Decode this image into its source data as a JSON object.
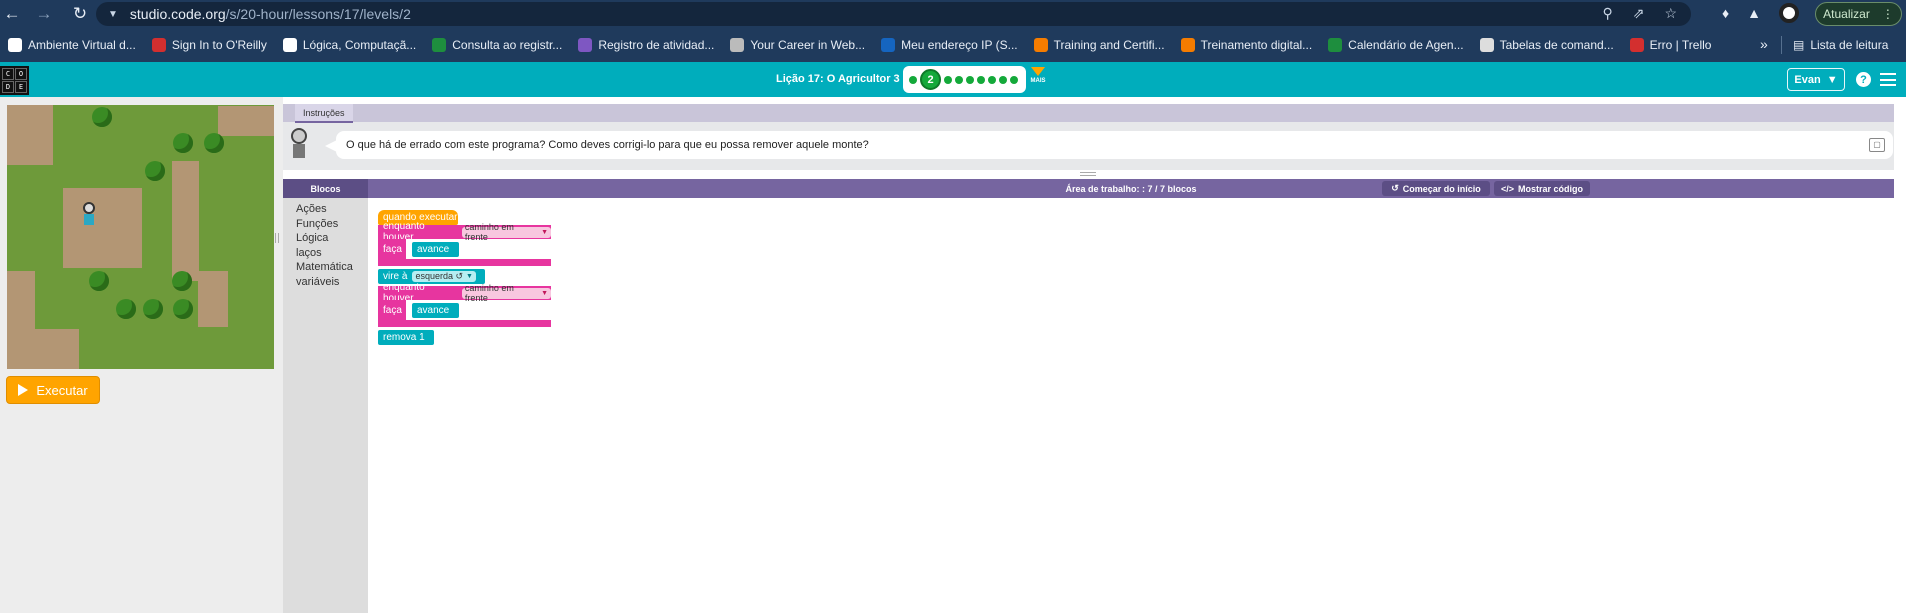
{
  "browser": {
    "url_host": "studio.code.org",
    "url_path": "/s/20-hour/lessons/17/levels/2",
    "update_label": "Atualizar",
    "more_bookmarks": "»",
    "reading_list": "Lista de leitura",
    "bookmarks": [
      {
        "label": "Ambiente Virtual d...",
        "color": "#ffffff"
      },
      {
        "label": "Sign In to O'Reilly",
        "color": "#d32f2f"
      },
      {
        "label": "Lógica, Computaçã...",
        "color": "#ffffff"
      },
      {
        "label": "Consulta ao registr...",
        "color": "#1e8e3e"
      },
      {
        "label": "Registro de atividad...",
        "color": "#7e57c2"
      },
      {
        "label": "Your Career in Web...",
        "color": "#bbbbbb"
      },
      {
        "label": "Meu endereço IP (S...",
        "color": "#1565c0"
      },
      {
        "label": "Training and Certifi...",
        "color": "#f57c00"
      },
      {
        "label": "Treinamento digital...",
        "color": "#f57c00"
      },
      {
        "label": "Calendário de Agen...",
        "color": "#1e8e3e"
      },
      {
        "label": "Tabelas de comand...",
        "color": "#dddddd"
      },
      {
        "label": "Erro | Trello",
        "color": "#d32f2f"
      }
    ]
  },
  "header": {
    "logo_letters": [
      "C",
      "O",
      "D",
      "E"
    ],
    "lesson_title": "Lição 17: O Agricultor 3",
    "current_level": "2",
    "more_label": "MAIS",
    "user_name": "Evan",
    "help_label": "?"
  },
  "run_label": "Executar",
  "instructions": {
    "tab_label": "Instruções",
    "text": "O que há de errado com este programa? Como deves corrigi-lo para que eu possa remover aquele monte?"
  },
  "workspace": {
    "toolbox_title": "Blocos",
    "title": "Área de trabalho: : 7 / 7 blocos",
    "reset_label": "Começar do início",
    "show_code_label": "Mostrar código",
    "categories": [
      "Ações",
      "Funções",
      "Lógica",
      "laços",
      "Matemática",
      "variáveis"
    ]
  },
  "blocks": {
    "when_run": "quando executar",
    "while_1": "enquanto houver",
    "while_1_field": "caminho em frente",
    "do_1": "faça",
    "move_1": "avance",
    "turn": "vire à",
    "turn_field": "esquerda ↺",
    "while_2": "enquanto houver",
    "while_2_field": "caminho em frente",
    "do_2": "faça",
    "move_2": "avance",
    "remove": "remova 1"
  }
}
